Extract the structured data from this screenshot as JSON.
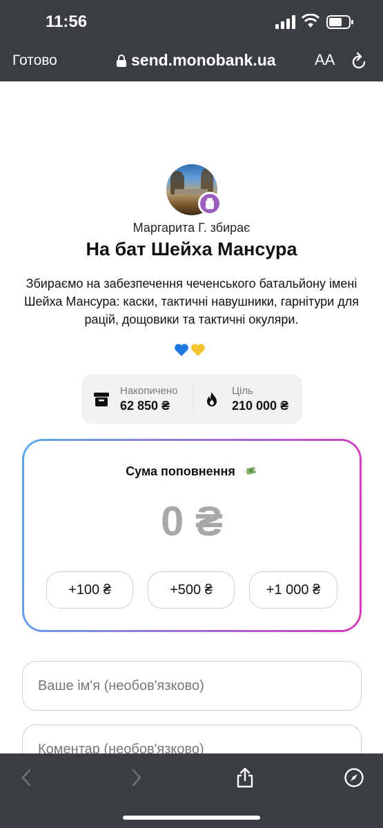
{
  "status_bar": {
    "time": "11:56"
  },
  "browser": {
    "done_label": "Готово",
    "url": "send.monobank.ua",
    "text_size_label": "AA"
  },
  "jar": {
    "owner_line": "Маргарита Г. збирає",
    "title": "На бат Шейха Мансура",
    "description": "Збираємо на забезпечення чеченського батальйону імені Шейха Мансура: каски, тактичні навушники, гарнітури для рацій, дощовики та тактичні окуляри.",
    "hearts": [
      "💙",
      "💛"
    ],
    "stats": {
      "collected_label": "Накопичено",
      "collected_value": "62 850 ₴",
      "goal_label": "Ціль",
      "goal_value": "210 000 ₴"
    }
  },
  "amount": {
    "label": "Сума поповнення",
    "value": "0 ₴",
    "quick_buttons": [
      "+100 ₴",
      "+500 ₴",
      "+1 000 ₴"
    ]
  },
  "form": {
    "name_placeholder": "Ваше ім'я (необов'язково)",
    "comment_placeholder": "Коментар (необов'язково)"
  },
  "icons": {
    "collected": "archive-box-icon",
    "goal": "flame-icon",
    "money": "money-wings-icon"
  },
  "colors": {
    "bar_background": "#3a3d42",
    "card_gradient_start": "#5aa8f0",
    "card_gradient_end": "#d83ab8",
    "jar_badge": "#9b5fc0"
  }
}
